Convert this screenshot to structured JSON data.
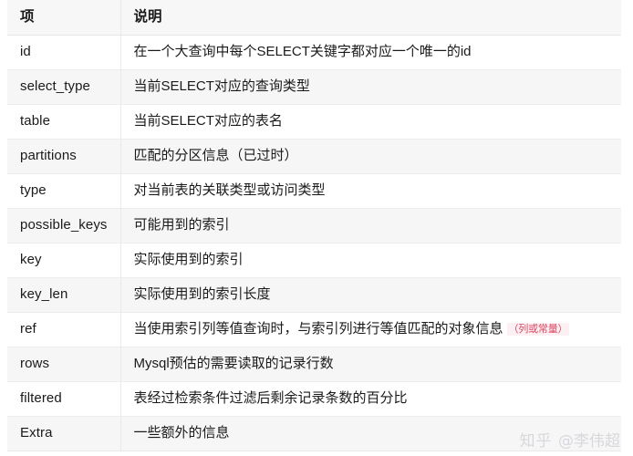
{
  "table": {
    "headers": {
      "item": "项",
      "description": "说明"
    },
    "rows": [
      {
        "item": "id",
        "description": "在一个大查询中每个SELECT关键字都对应一个唯一的id"
      },
      {
        "item": "select_type",
        "description": "当前SELECT对应的查询类型"
      },
      {
        "item": "table",
        "description": "当前SELECT对应的表名"
      },
      {
        "item": "partitions",
        "description": "匹配的分区信息（已过时）"
      },
      {
        "item": "type",
        "description": "对当前表的关联类型或访问类型"
      },
      {
        "item": "possible_keys",
        "description": "可能用到的索引"
      },
      {
        "item": "key",
        "description": "实际使用到的索引"
      },
      {
        "item": "key_len",
        "description": "实际使用到的索引长度"
      },
      {
        "item": "ref",
        "description": "当使用索引列等值查询时，与索引列进行等值匹配的对象信息",
        "note": "（列或常量）"
      },
      {
        "item": "rows",
        "description": "Mysql预估的需要读取的记录行数"
      },
      {
        "item": "filtered",
        "description": "表经过检索条件过滤后剩余记录条数的百分比"
      },
      {
        "item": "Extra",
        "description": "一些额外的信息"
      }
    ]
  },
  "watermark": {
    "site": "知乎",
    "author": "@李伟超"
  },
  "colors": {
    "note_text": "#d94862",
    "note_background": "#fdf0f3",
    "header_background": "#f7f7f8",
    "stripe_background": "#f6f6f7",
    "border": "#e9e9ec",
    "text": "#1a1a1a",
    "watermark": "#d8d8dc"
  }
}
